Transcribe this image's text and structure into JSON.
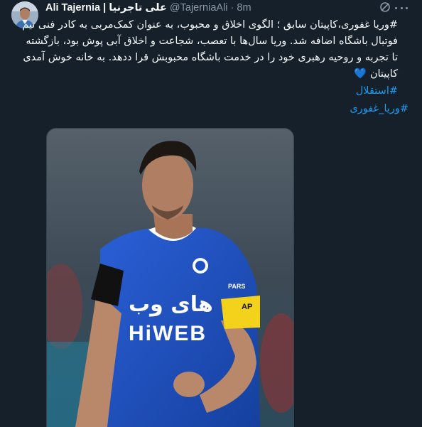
{
  "tweet": {
    "display_name": "Ali Tajernia | علی تاجرنیا",
    "handle": "@TajerniaAli",
    "separator": "·",
    "time": "8m",
    "lines": [
      "#وریا غفوری،کاپیتان سابق ؛ الگوی اخلاق و محبوب، به عنوان کمک‌مربی به کادر فنی تیم",
      "فوتبال باشگاه اضافه شد. وریا سال‌ها با تعصب، شجاعت و اخلاق آبی پوش بود،  بازگشته",
      "تا تجربه و روحیه رهبری خود را در خدمت  باشگاه محبوبش قرا ددهد. به خانه خوش آمدی",
      "کاپیتان"
    ],
    "heart_emoji": "💙",
    "hashtags": [
      "#استقلال",
      "#وریا_غفوری"
    ]
  },
  "media": {
    "jersey_sponsor_fa": "های وب",
    "jersey_sponsor_en": "HiWEB",
    "captain_band": "AP",
    "sleeve_text": "PARS"
  },
  "colors": {
    "background": "#15202b",
    "text": "#f7f9f9",
    "muted": "#8b98a5",
    "link": "#1d9bf0",
    "jersey": "#1b4fc4"
  },
  "icons": {
    "grok": "grok-icon",
    "more": "more-icon"
  }
}
